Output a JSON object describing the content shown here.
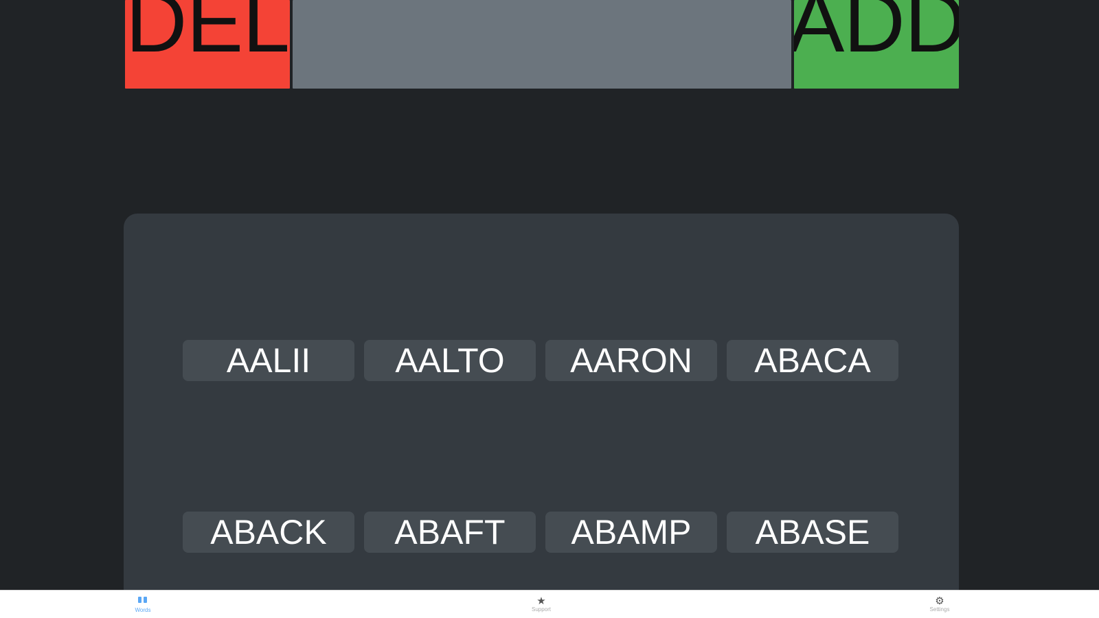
{
  "header": {
    "del_label": "DEL",
    "add_label": "ADD",
    "input_value": ""
  },
  "words": [
    "AALII",
    "AALTO",
    "AARON",
    "ABACA",
    "ABACK",
    "ABAFT",
    "ABAMP",
    "ABASE"
  ],
  "tabs": [
    {
      "label": "Words",
      "icon": "words-icon",
      "active": true
    },
    {
      "label": "Support",
      "icon": "star-icon",
      "active": false
    },
    {
      "label": "Settings",
      "icon": "gear-icon",
      "active": false
    }
  ],
  "colors": {
    "background": "#202326",
    "delete": "#f44336",
    "add": "#4caf50",
    "input": "#6c757d",
    "panel": "#343a40",
    "chip": "#454c52",
    "active_tab": "#5aa7f5"
  }
}
